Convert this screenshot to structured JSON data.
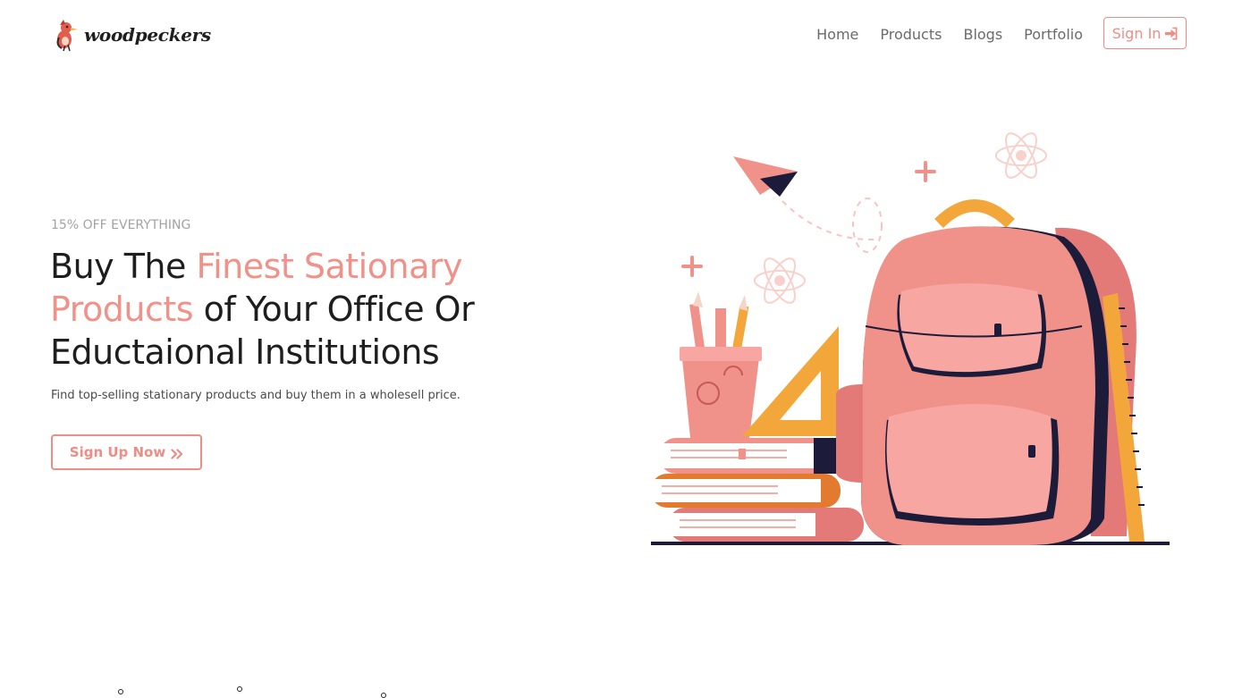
{
  "navbar": {
    "brand_name": "woodpeckers",
    "links": [
      "Home",
      "Products",
      "Blogs",
      "Portfolio"
    ],
    "signin_label": "Sign In"
  },
  "hero": {
    "eyebrow": "15% OFF EVERYTHING",
    "headline_part1": "Buy The ",
    "headline_accent1": "Finest Sationary Products",
    "headline_part2": " of Your Office Or Eductaional Institutions",
    "subtext": "Find top-selling stationary products and buy them in a wholesell price.",
    "cta_label": "Sign Up Now"
  },
  "colors": {
    "accent": "#ee8c86",
    "text_dark": "#1e1e1e",
    "muted": "#a3a3a3"
  },
  "icons": [
    "woodpecker-logo-icon",
    "sign-in-icon",
    "double-chevron-right-icon"
  ]
}
